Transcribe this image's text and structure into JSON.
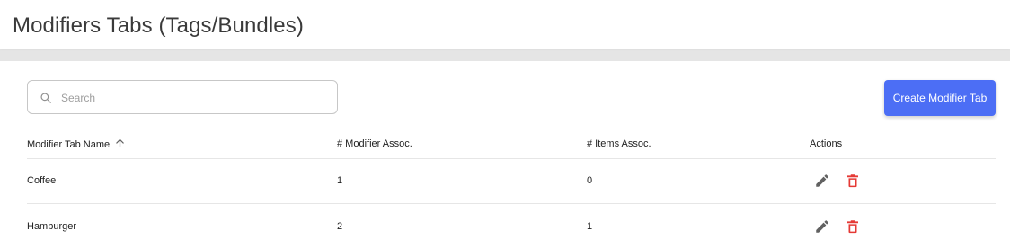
{
  "header": {
    "title": "Modifiers Tabs (Tags/Bundles)"
  },
  "toolbar": {
    "search_placeholder": "Search",
    "create_label": "Create Modifier Tab"
  },
  "table": {
    "columns": [
      "Modifier Tab Name",
      "# Modifier Assoc.",
      "# Items Assoc.",
      "Actions"
    ],
    "sort": {
      "column": "Modifier Tab Name",
      "direction": "ascending"
    },
    "rows": [
      {
        "name": "Coffee",
        "modifier_assoc": "1",
        "items_assoc": "0"
      },
      {
        "name": "Hamburger",
        "modifier_assoc": "2",
        "items_assoc": "1"
      }
    ]
  },
  "icons": {
    "search": "search-icon",
    "sort": "arrow-up-icon",
    "edit": "pencil-icon",
    "delete": "trash-icon"
  },
  "colors": {
    "primary": "#4c6ef5",
    "delete": "#e53935",
    "edit": "#616161",
    "band": "#e5e5e5"
  }
}
